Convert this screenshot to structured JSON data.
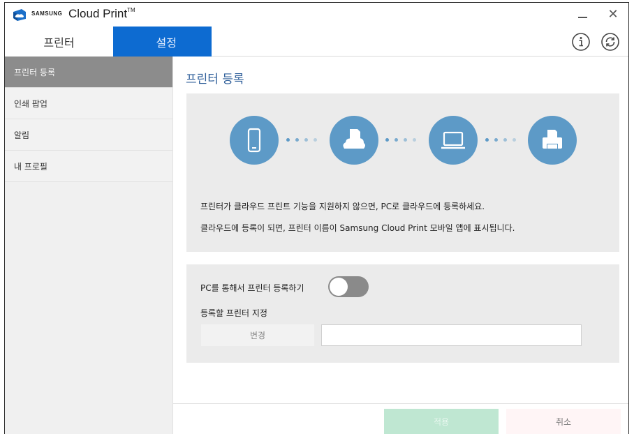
{
  "app": {
    "brand_small": "SAMSUNG",
    "brand_name": "Cloud Print",
    "brand_tm": "TM",
    "minimize_icon": "minimize-icon",
    "close_icon": "close-icon",
    "close_glyph": "✕"
  },
  "tabs": [
    {
      "label": "프린터",
      "active": false
    },
    {
      "label": "설정",
      "active": true
    }
  ],
  "header_icons": [
    "info-icon",
    "refresh-icon"
  ],
  "sidebar": {
    "items": [
      {
        "label": "프린터 등록",
        "active": true
      },
      {
        "label": "인쇄 팝업",
        "active": false
      },
      {
        "label": "알림",
        "active": false
      },
      {
        "label": "내 프로필",
        "active": false
      }
    ]
  },
  "main": {
    "title": "프린터 등록",
    "flow_icons": [
      "phone-icon",
      "cloud-document-icon",
      "laptop-icon",
      "printer-icon"
    ],
    "info_line1": "프린터가 클라우드 프린트 기능을 지원하지 않으면, PC로 클라우드에 등록하세요.",
    "info_line2": "클라우드에 등록이 되면, 프린터 이름이 Samsung Cloud Print 모바일 앱에 표시됩니다.",
    "register_via_pc_label": "PC를 통해서 프린터 등록하기",
    "register_toggle_on": false,
    "assign_printer_label": "등록할 프린터 지정",
    "change_button": "변경",
    "printer_field_value": ""
  },
  "footer": {
    "apply_button": "적용",
    "cancel_button": "취소"
  },
  "colors": {
    "accent": "#0d6bd1",
    "icon_circle": "#5d9ac7",
    "sidebar_active": "#8c8c8c",
    "apply_disabled": "#bfe7d2"
  }
}
